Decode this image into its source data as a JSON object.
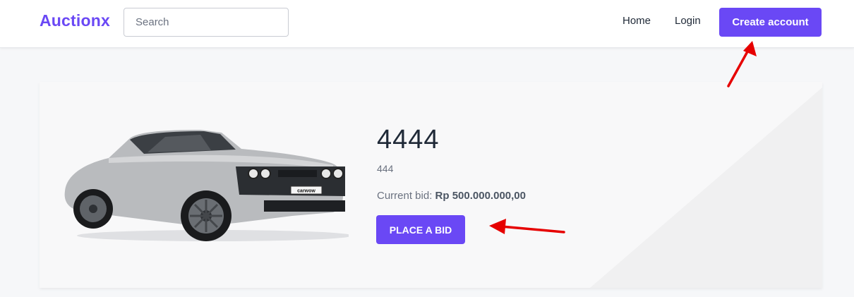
{
  "navbar": {
    "brand": "Auctionx",
    "search_placeholder": "Search",
    "links": [
      {
        "label": "Home"
      },
      {
        "label": "Login"
      }
    ],
    "cta_label": "Create account"
  },
  "auction": {
    "title": "4444",
    "description": "444",
    "current_bid_label": "Current bid:",
    "current_bid_value": "Rp 500.000.000,00",
    "bid_button_label": "PLACE A BID",
    "car_plate_text": "carwow"
  },
  "colors": {
    "accent": "#6a48f5",
    "annotation_arrow": "#e60000",
    "page_background": "#f6f7f9"
  }
}
